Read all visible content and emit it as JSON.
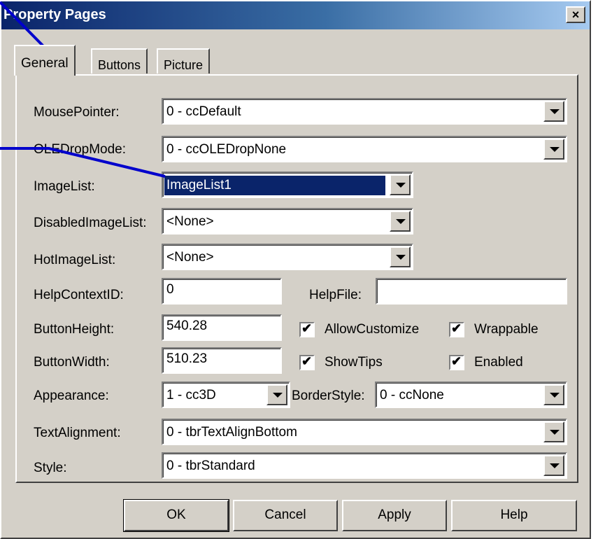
{
  "window": {
    "title": "Property Pages",
    "close_label": "×"
  },
  "tabs": [
    {
      "label": "General",
      "active": true
    },
    {
      "label": "Buttons",
      "active": false
    },
    {
      "label": "Picture",
      "active": false
    }
  ],
  "form": {
    "mouse_pointer": {
      "label": "MousePointer:",
      "value": "0 - ccDefault"
    },
    "ole_drop_mode": {
      "label": "OLEDropMode:",
      "value": "0 - ccOLEDropNone"
    },
    "image_list": {
      "label": "ImageList:",
      "value": "ImageList1"
    },
    "disabled_image_list": {
      "label": "DisabledImageList:",
      "value": "<None>"
    },
    "hot_image_list": {
      "label": "HotImageList:",
      "value": "<None>"
    },
    "help_context_id": {
      "label": "HelpContextID:",
      "value": "0"
    },
    "help_file": {
      "label": "HelpFile:",
      "value": ""
    },
    "button_height": {
      "label": "ButtonHeight:",
      "value": "540.28"
    },
    "button_width": {
      "label": "ButtonWidth:",
      "value": "510.23"
    },
    "allow_customize": {
      "label": "AllowCustomize",
      "checked": true
    },
    "wrappable": {
      "label": "Wrappable",
      "checked": true
    },
    "show_tips": {
      "label": "ShowTips",
      "checked": true
    },
    "enabled": {
      "label": "Enabled",
      "checked": true
    },
    "appearance": {
      "label": "Appearance:",
      "value": "1 - cc3D"
    },
    "border_style": {
      "label": "BorderStyle:",
      "value": "0 - ccNone"
    },
    "text_alignment": {
      "label": "TextAlignment:",
      "value": "0 - tbrTextAlignBottom"
    },
    "style": {
      "label": "Style:",
      "value": "0 - tbrStandard"
    }
  },
  "buttons": {
    "ok": "OK",
    "cancel": "Cancel",
    "apply": "Apply",
    "help": "Help"
  },
  "colors": {
    "title_start": "#0a246a",
    "title_end": "#a6caf0",
    "face": "#d4d0c8",
    "selection": "#0a246a",
    "callout": "#0000cc"
  }
}
